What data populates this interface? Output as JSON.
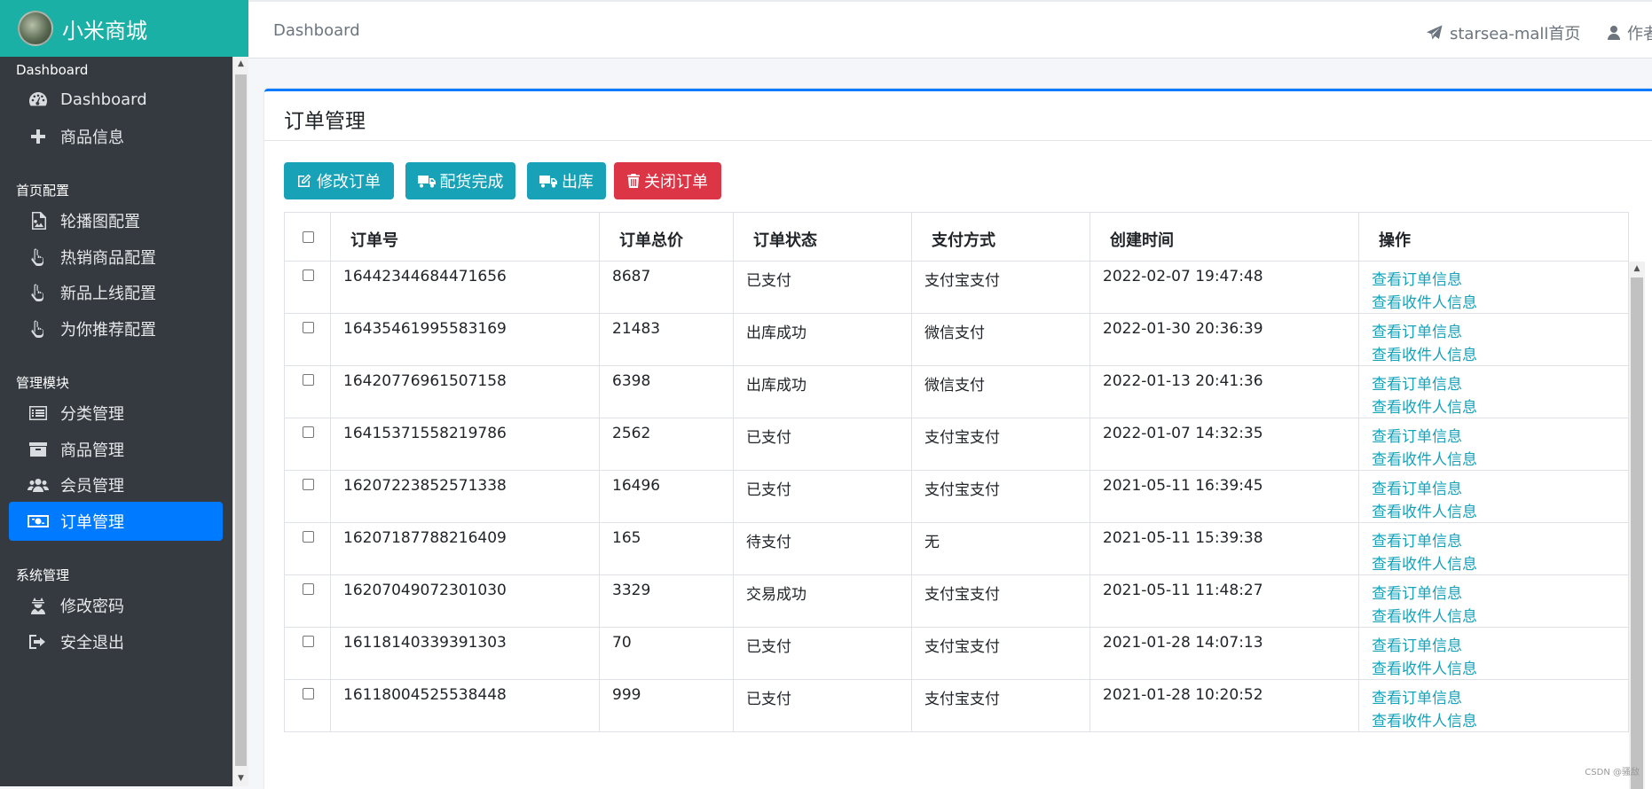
{
  "brand": {
    "name": "小米商城"
  },
  "sidebar": {
    "sections": [
      {
        "header": "Dashboard",
        "items": [
          {
            "label": "Dashboard",
            "icon": "dashboard-icon"
          },
          {
            "label": "商品信息",
            "icon": "plus-icon"
          }
        ]
      },
      {
        "header": "首页配置",
        "items": [
          {
            "label": "轮播图配置",
            "icon": "image-icon"
          },
          {
            "label": "热销商品配置",
            "icon": "hand-pointer-icon"
          },
          {
            "label": "新品上线配置",
            "icon": "hand-pointer-icon"
          },
          {
            "label": "为你推荐配置",
            "icon": "hand-pointer-icon"
          }
        ]
      },
      {
        "header": "管理模块",
        "items": [
          {
            "label": "分类管理",
            "icon": "list-icon"
          },
          {
            "label": "商品管理",
            "icon": "archive-icon"
          },
          {
            "label": "会员管理",
            "icon": "users-icon"
          },
          {
            "label": "订单管理",
            "icon": "money-bill-icon",
            "active": true
          }
        ]
      },
      {
        "header": "系统管理",
        "items": [
          {
            "label": "修改密码",
            "icon": "user-secret-icon"
          },
          {
            "label": "安全退出",
            "icon": "sign-out-icon"
          }
        ]
      }
    ]
  },
  "navbar": {
    "breadcrumb": "Dashboard",
    "home_link": "starsea-mall首页",
    "author_link": "作者"
  },
  "card": {
    "title": "订单管理",
    "buttons": {
      "edit": "修改订单",
      "pack": "配货完成",
      "ship": "出库",
      "close": "关闭订单"
    }
  },
  "table": {
    "headers": [
      "订单号",
      "订单总价",
      "订单状态",
      "支付方式",
      "创建时间",
      "操作"
    ],
    "actions": {
      "view_order": "查看订单信息",
      "view_receiver": "查看收件人信息"
    },
    "rows": [
      {
        "order_no": "16442344684471656",
        "total": "8687",
        "status": "已支付",
        "pay": "支付宝支付",
        "created": "2022-02-07 19:47:48"
      },
      {
        "order_no": "16435461995583169",
        "total": "21483",
        "status": "出库成功",
        "pay": "微信支付",
        "created": "2022-01-30 20:36:39"
      },
      {
        "order_no": "16420776961507158",
        "total": "6398",
        "status": "出库成功",
        "pay": "微信支付",
        "created": "2022-01-13 20:41:36"
      },
      {
        "order_no": "16415371558219786",
        "total": "2562",
        "status": "已支付",
        "pay": "支付宝支付",
        "created": "2022-01-07 14:32:35"
      },
      {
        "order_no": "16207223852571338",
        "total": "16496",
        "status": "已支付",
        "pay": "支付宝支付",
        "created": "2021-05-11 16:39:45"
      },
      {
        "order_no": "16207187788216409",
        "total": "165",
        "status": "待支付",
        "pay": "无",
        "created": "2021-05-11 15:39:38"
      },
      {
        "order_no": "16207049072301030",
        "total": "3329",
        "status": "交易成功",
        "pay": "支付宝支付",
        "created": "2021-05-11 11:48:27"
      },
      {
        "order_no": "16118140339391303",
        "total": "70",
        "status": "已支付",
        "pay": "支付宝支付",
        "created": "2021-01-28 14:07:13"
      },
      {
        "order_no": "16118004525538448",
        "total": "999",
        "status": "已支付",
        "pay": "支付宝支付",
        "created": "2021-01-28 10:20:52"
      }
    ]
  },
  "watermark": "CSDN @骚敌"
}
